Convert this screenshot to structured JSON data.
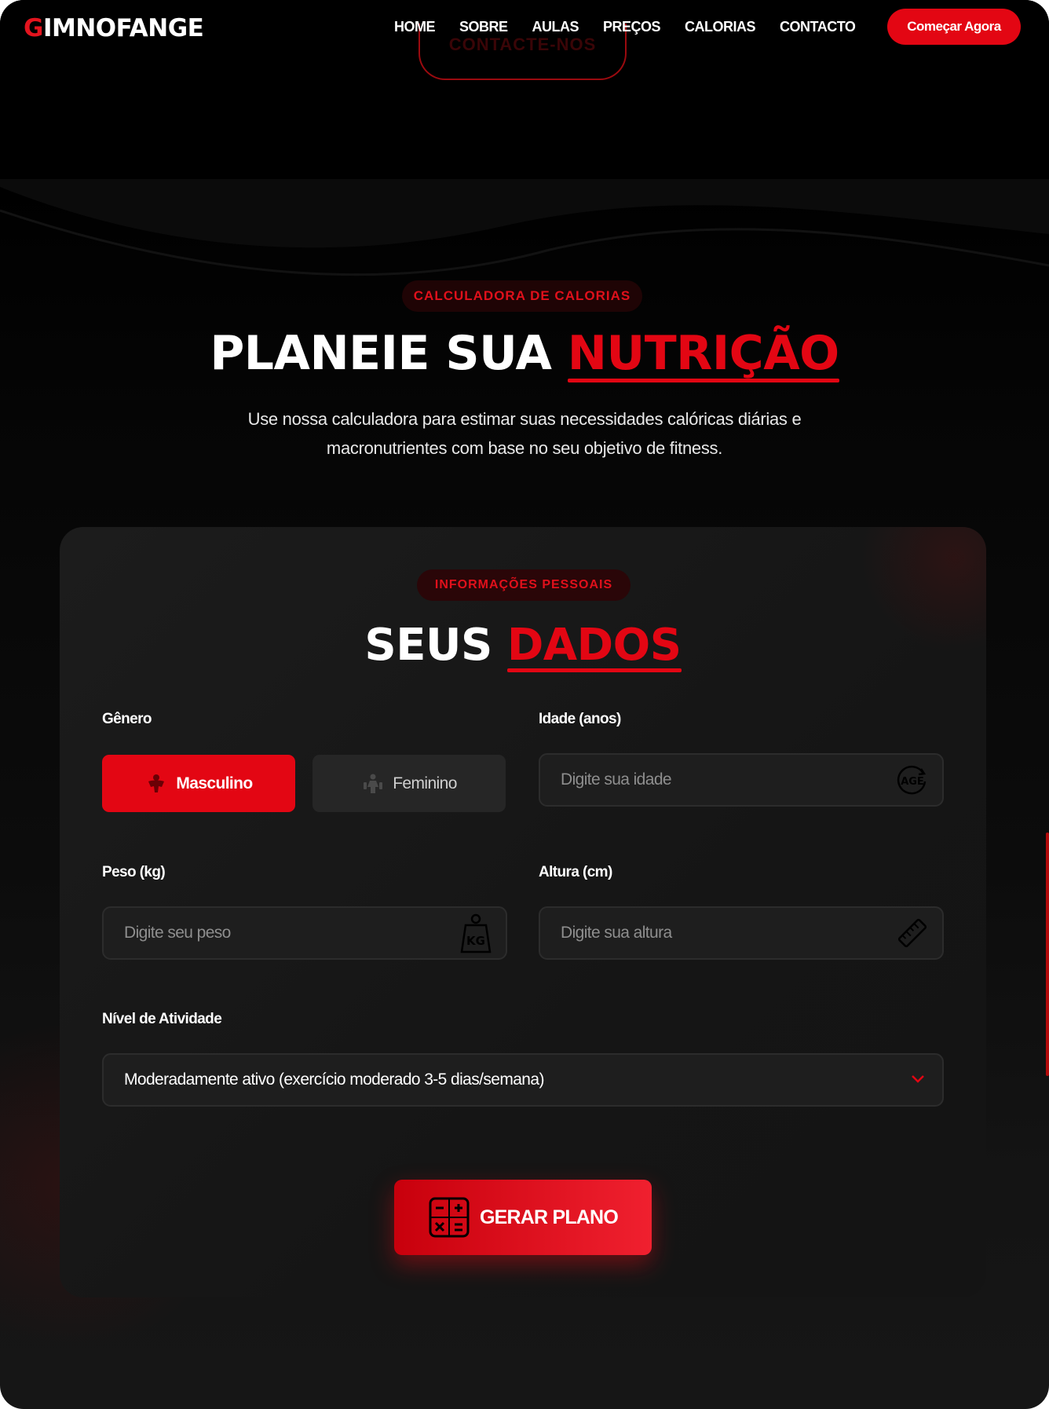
{
  "nav": {
    "logo_first": "G",
    "logo_rest": "IMNOFANGE",
    "links": [
      "HOME",
      "SOBRE",
      "AULAS",
      "PREÇOS",
      "CALORIAS",
      "CONTACTO"
    ],
    "cta": "Começar Agora",
    "prev_button": "CONTACTE-NOS"
  },
  "hero": {
    "badge": "CALCULADORA DE CALORIAS",
    "title_main": "PLANEIE SUA",
    "title_accent": "NUTRIÇÃO",
    "subtitle_line1": "Use nossa calculadora para estimar suas necessidades calóricas diárias e",
    "subtitle_line2": "macronutrientes com base no seu objetivo de fitness."
  },
  "form": {
    "badge": "INFORMAÇÕES PESSOAIS",
    "title_main": "SEUS",
    "title_accent": "DADOS",
    "gender": {
      "label": "Gênero",
      "male": "Masculino",
      "female": "Feminino",
      "selected": "Masculino"
    },
    "age": {
      "label": "Idade (anos)",
      "placeholder": "Digite sua idade",
      "icon": "age-icon"
    },
    "weight": {
      "label": "Peso (kg)",
      "placeholder": "Digite seu peso",
      "icon": "kg-weight-icon"
    },
    "height": {
      "label": "Altura (cm)",
      "placeholder": "Digite sua altura",
      "icon": "ruler-icon"
    },
    "activity": {
      "label": "Nível de Atividade",
      "value": "Moderadamente ativo (exercício moderado 3-5 dias/semana)"
    },
    "submit": "GERAR PLANO"
  },
  "colors": {
    "accent": "#e30613",
    "background": "#000000",
    "card": "#181818",
    "field": "#1e1e1e"
  }
}
